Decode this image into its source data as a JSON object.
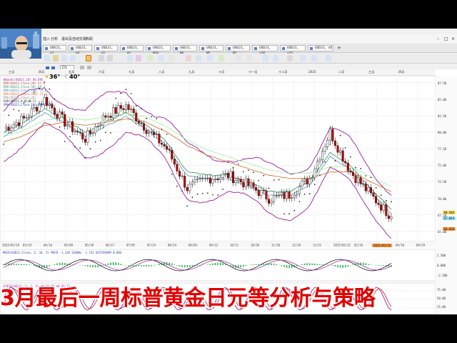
{
  "menubar": {
    "items": [
      "插入",
      "分析",
      "退出及自动交易",
      "热助"
    ]
  },
  "tabs": [
    {
      "label": "USDJ1, d1"
    },
    {
      "label": "USDJ1, H4"
    },
    {
      "label": "USDJ1, H1"
    },
    {
      "label": "USDJ1, W1"
    },
    {
      "label": "USDJ1, M30"
    },
    {
      "label": "USDJ1, M6"
    },
    {
      "label": "USDJ1, M5"
    },
    {
      "label": "USDJ1, M2"
    },
    {
      "label": "USDJ1, a30"
    },
    {
      "label": "USDJ1, a15"
    },
    {
      "label": "USDJ1, m5"
    }
  ],
  "toolbar2": {
    "timeframe": "D1"
  },
  "weather": {
    "temp1": "36°",
    "temp2": "40°"
  },
  "months": [
    "三月",
    "四月",
    "五月",
    "六月",
    "七月",
    "八月",
    "九月",
    "十月",
    "十一月",
    "十二月",
    "2025",
    "二月",
    "三月",
    "四月"
  ],
  "price_axis": [
    "87.50",
    "85.00",
    "82.50",
    "80.00",
    "77.50",
    "75.00",
    "72.50",
    "70.00",
    "67.50",
    "65.00"
  ],
  "price_badges": {
    "top": "68.566",
    "mid": "67.034",
    "low": "66.026",
    "date": "2025/03/24"
  },
  "x_dates": [
    "2024/02/19",
    "03/19",
    "04/16",
    "05/09",
    "05/30",
    "06/17",
    "07/05",
    "07/24",
    "08/14",
    "09/03",
    "09/22",
    "10/11",
    "10/30",
    "11/20",
    "12/10",
    "12/31",
    "2025/01/21",
    "02/10",
    "03/01",
    "04/10",
    "04/29"
  ],
  "legend": [
    {
      "text": "BBands(USDJ1,20)  86.895",
      "color": "#9a1ea0"
    },
    {
      "text": "EMA(USDJ1,Close,20)  67.9",
      "color": "#c0392b"
    },
    {
      "text": "EMA(USDJ1,Close,50)  69.3",
      "color": "#2e8b57"
    },
    {
      "text": "EMA(USDJ1,Close,100)  71.0",
      "color": "#4682b4"
    },
    {
      "text": "EMA(USDJ1,Close,200)  71.2",
      "color": "#d2691e"
    },
    {
      "text": "EMA(USDJ1,Close,26)",
      "color": "#888888"
    },
    {
      "text": "SAR(USDJ1,0.02,0.2)",
      "color": "#222222"
    },
    {
      "text": "SMA(USDJ1,Close,10)  AO  65.790",
      "color": "#1f3f9f"
    }
  ],
  "macd": {
    "label": "MACD(USDJ1,Close, 5, 34, 5)  MACD -1.128  SIGNAL -1.732  HISTOGRAM 0.604",
    "axis": [
      "2.500",
      "0.000",
      "-2.500"
    ]
  },
  "stoch": {
    "label": "STOCH(USDJ1, 5, 3, 3)  %K 41.45  %D 45.73",
    "axis": [
      "75.00",
      "50.00",
      "25.00"
    ]
  },
  "chart_data": {
    "type": "line",
    "title": "",
    "xlabel": "",
    "ylabel": "",
    "ylim": [
      64,
      88
    ],
    "x": [
      "2024/02/19",
      "03/19",
      "04/16",
      "05/09",
      "05/30",
      "06/17",
      "07/05",
      "07/24",
      "08/14",
      "09/03",
      "09/22",
      "10/11",
      "10/30",
      "11/20",
      "12/10",
      "12/31",
      "2025/01/21",
      "02/10",
      "03/01",
      "03/24"
    ],
    "series": [
      {
        "name": "USDJ1 close",
        "values": [
          80.5,
          82.0,
          85.0,
          81.5,
          79.0,
          82.5,
          84.0,
          80.5,
          77.5,
          71.5,
          73.0,
          73.5,
          72.0,
          70.0,
          70.5,
          73.0,
          80.0,
          74.0,
          70.5,
          67.2
        ]
      },
      {
        "name": "EMA 20",
        "values": [
          80.0,
          81.5,
          83.5,
          82.0,
          80.0,
          81.5,
          83.0,
          81.0,
          78.5,
          74.0,
          73.5,
          73.5,
          72.5,
          71.0,
          71.0,
          72.5,
          77.0,
          75.0,
          71.5,
          68.3
        ]
      },
      {
        "name": "EMA 100",
        "values": [
          78.5,
          79.5,
          81.0,
          81.5,
          81.0,
          81.5,
          82.0,
          81.5,
          80.0,
          78.0,
          76.5,
          75.5,
          74.5,
          73.5,
          73.0,
          73.0,
          74.0,
          74.0,
          72.5,
          71.0
        ]
      }
    ]
  },
  "headline": "3月最后一周标普黄金日元等分析与策略"
}
